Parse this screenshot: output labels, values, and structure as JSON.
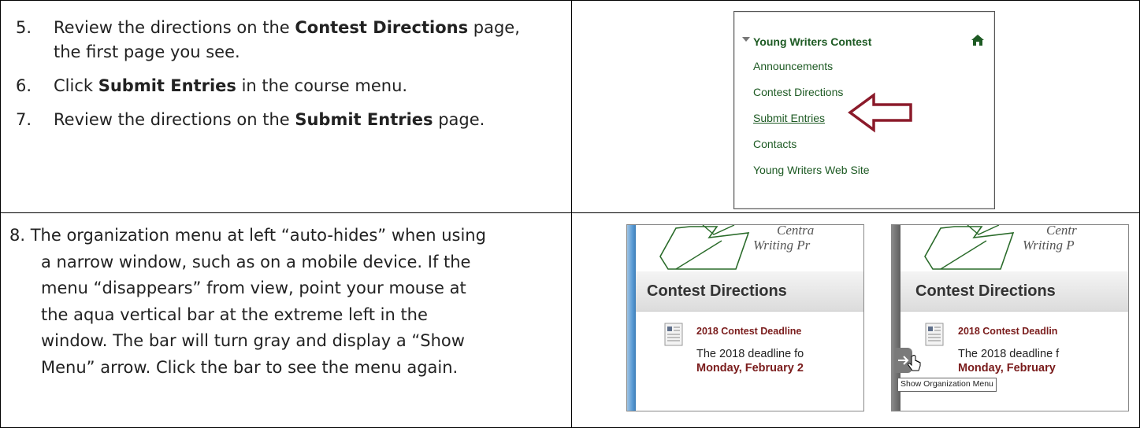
{
  "steps": [
    {
      "num": "5.",
      "before": "Review the directions on the ",
      "bold": "Contest Directions",
      "after": " page,",
      "cont": "the first page you see."
    },
    {
      "num": "6.",
      "before": "Click ",
      "bold": "Submit Entries",
      "after": " in the course menu."
    },
    {
      "num": "7.",
      "before": "Review the directions on the ",
      "bold": "Submit Entries",
      "after": " page."
    }
  ],
  "step8": {
    "lines": [
      "8. The organization menu at left “auto-hides” when using",
      "a narrow window, such as on a mobile device. If the",
      "menu “disappears” from view, point your mouse at",
      "the aqua vertical bar at the extreme left in the",
      "window. The bar will turn gray and display a “Show",
      "Menu” arrow. Click the bar to see the menu again."
    ]
  },
  "course_menu": {
    "title": "Young Writers Contest",
    "items": [
      "Announcements",
      "Contest Directions",
      "Submit Entries",
      "Contacts",
      "Young Writers Web Site"
    ],
    "highlighted_item": "Submit Entries",
    "icons": {
      "expand": "caret-down-icon",
      "home": "home-icon",
      "pointer": "red-arrow-icon"
    },
    "colors": {
      "link": "#1d5a23",
      "arrow": "#8b1a2a"
    }
  },
  "contest_shot_left": {
    "logo_line1": "Centra",
    "logo_line2": "Writing Pr",
    "title": "Contest Directions",
    "item_title": "2018 Contest Deadline",
    "item_text": "The 2018 deadline fo",
    "item_date": "Monday, February 2",
    "bar_color": "#5b9bd5"
  },
  "contest_shot_right": {
    "logo_line1": "Centr",
    "logo_line2": "Writing P",
    "title": "Contest Directions",
    "item_title": "2018 Contest Deadlin",
    "item_text": "The 2018 deadline f",
    "item_date": "Monday, February",
    "tooltip": "Show Organization Menu",
    "bar_color": "#6a6a6a"
  }
}
